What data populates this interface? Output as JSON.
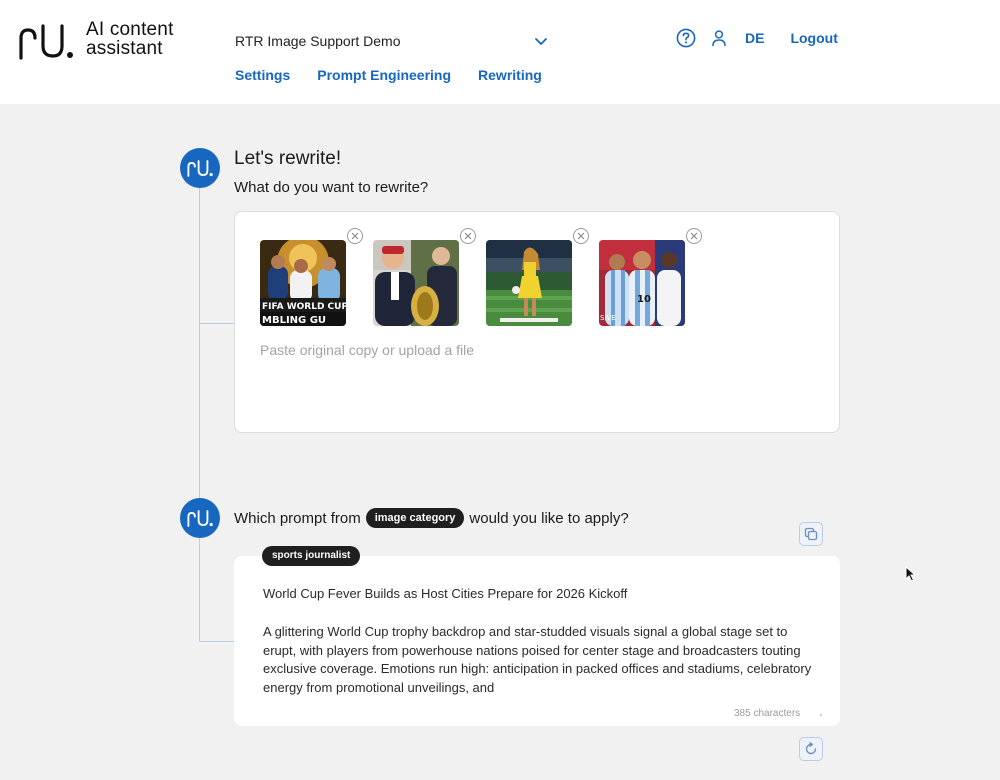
{
  "header": {
    "logo_line1": "AI content",
    "logo_line2": "assistant",
    "project": "RTR Image Support Demo",
    "nav": [
      "Settings",
      "Prompt Engineering",
      "Rewriting"
    ],
    "lang": "DE",
    "logout": "Logout",
    "icons": [
      "help-icon",
      "user-icon",
      "chevron-down-icon"
    ]
  },
  "colors": {
    "accent": "#1767c0",
    "background": "#f1f1f1",
    "chip": "#1f1f1f"
  },
  "step1": {
    "title": "Let's rewrite!",
    "subtitle": "What do you want to rewrite?",
    "placeholder": "Paste original copy or upload a file",
    "images": [
      {
        "alt": "FIFA World Cup gambling guide"
      },
      {
        "alt": "Officials with World Cup trophy"
      },
      {
        "alt": "Performer on stadium pitch"
      },
      {
        "alt": "Argentina players celebrating"
      }
    ]
  },
  "step2": {
    "question_pre": "Which prompt from",
    "chip": "image category",
    "question_post": "would you like to apply?",
    "tag": "sports journalist",
    "output_title": "World Cup Fever Builds as Host Cities Prepare for 2026 Kickoff",
    "output_body": "A glittering World Cup trophy backdrop and star-studded visuals signal a global stage set to erupt, with players from powerhouse nations poised for center stage and broadcasters touting exclusive coverage. Emotions run high: anticipation in packed offices and stadiums, celebratory energy from promotional unveilings, and",
    "char_count": "385 characters"
  }
}
